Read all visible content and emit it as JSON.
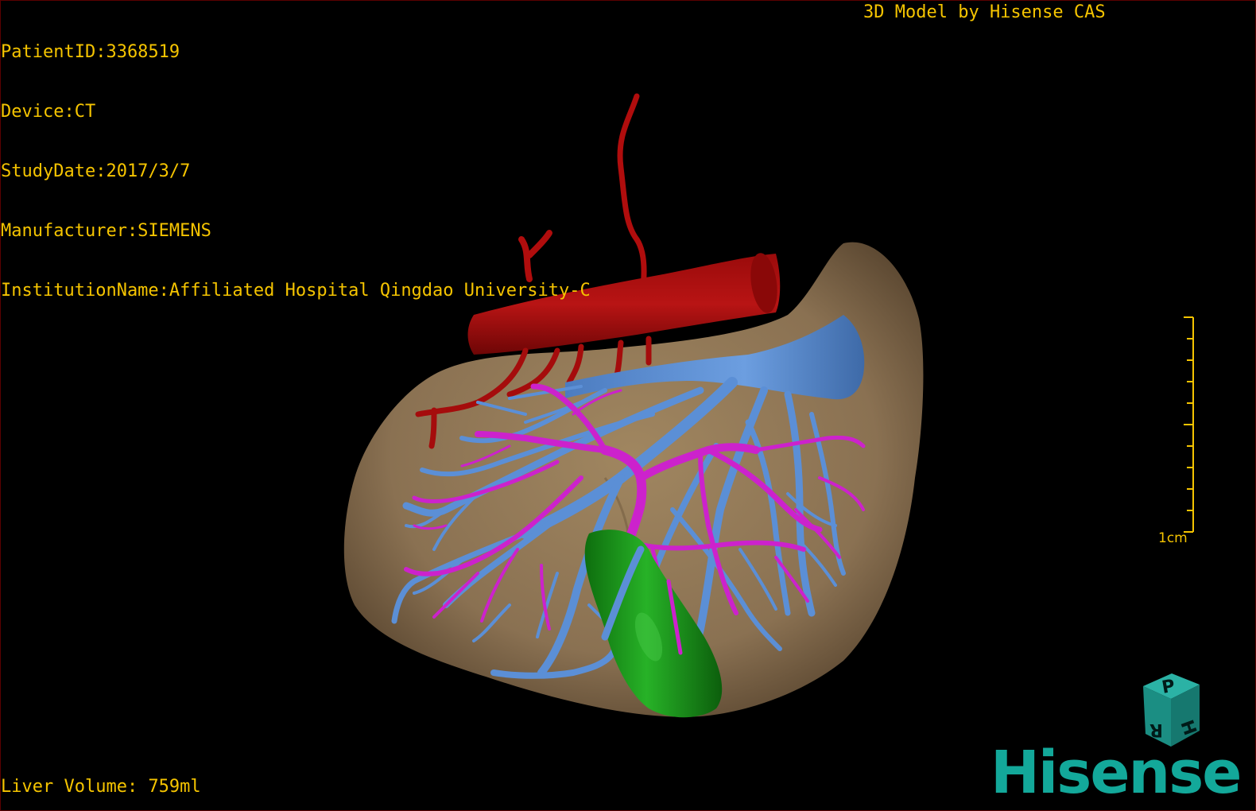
{
  "patient": {
    "id_line": "PatientID:3368519",
    "device_line": "Device:CT",
    "study_date_line": "StudyDate:2017/3/7",
    "manufacturer_line": "Manufacturer:SIEMENS",
    "institution_line": "InstitutionName:Affiliated Hospital Qingdao University-C"
  },
  "brand_title": "3D Model by Hisense CAS",
  "liver_volume": "Liver Volume: 759ml",
  "scale": {
    "label": "1cm"
  },
  "orientation_cube": {
    "icon": "orientation-cube-icon",
    "faces": [
      "P",
      "H",
      "R"
    ]
  },
  "logo": {
    "text": "Hisense",
    "color": "#13a89a"
  },
  "colors": {
    "overlay_text": "#f5c400",
    "liver": "#8a7152",
    "artery": "#b00d0d",
    "portal_vein": "#cc22cc",
    "hepatic_vein": "#5b8fd6",
    "gallbladder": "#1fa01f"
  }
}
